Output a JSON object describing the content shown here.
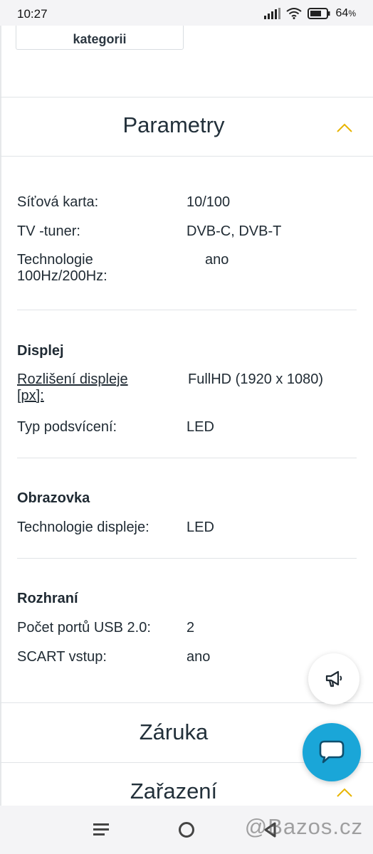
{
  "status_bar": {
    "time": "10:27",
    "battery_percent": "64",
    "battery_unit": "%"
  },
  "category_button": {
    "label": "kategorii"
  },
  "parametry": {
    "title": "Parametry",
    "rows": [
      {
        "label": "Síťová karta:",
        "value": "10/100"
      },
      {
        "label": "TV -tuner:",
        "value": "DVB-C, DVB-T"
      },
      {
        "label_line1": "Technologie",
        "label_line2": "100Hz/200Hz:",
        "value": "ano"
      }
    ]
  },
  "displej": {
    "title": "Displej",
    "rows": [
      {
        "label_line1": "Rozlišení displeje",
        "label_line2": "[px]:",
        "value": "FullHD (1920 x 1080)"
      },
      {
        "label": "Typ podsvícení:",
        "value": "LED"
      }
    ]
  },
  "obrazovka": {
    "title": "Obrazovka",
    "rows": [
      {
        "label": "Technologie displeje:",
        "value": "LED"
      }
    ]
  },
  "rozhrani": {
    "title": "Rozhraní",
    "rows": [
      {
        "label": "Počet portů USB 2.0:",
        "value": "2"
      },
      {
        "label": "SCART vstup:",
        "value": "ano"
      }
    ]
  },
  "zaruka": {
    "title": "Záruka"
  },
  "zarazeni": {
    "title": "Zařazení"
  },
  "watermark": "@Bazos.cz",
  "colors": {
    "accent_yellow": "#e8b400",
    "chat_blue": "#1aa6d8",
    "text_dark": "#1f2a33"
  },
  "icons": [
    "signal-icon",
    "wifi-icon",
    "battery-icon",
    "chevron-up-icon",
    "megaphone-icon",
    "chat-icon",
    "menu-icon",
    "home-icon",
    "back-icon"
  ]
}
